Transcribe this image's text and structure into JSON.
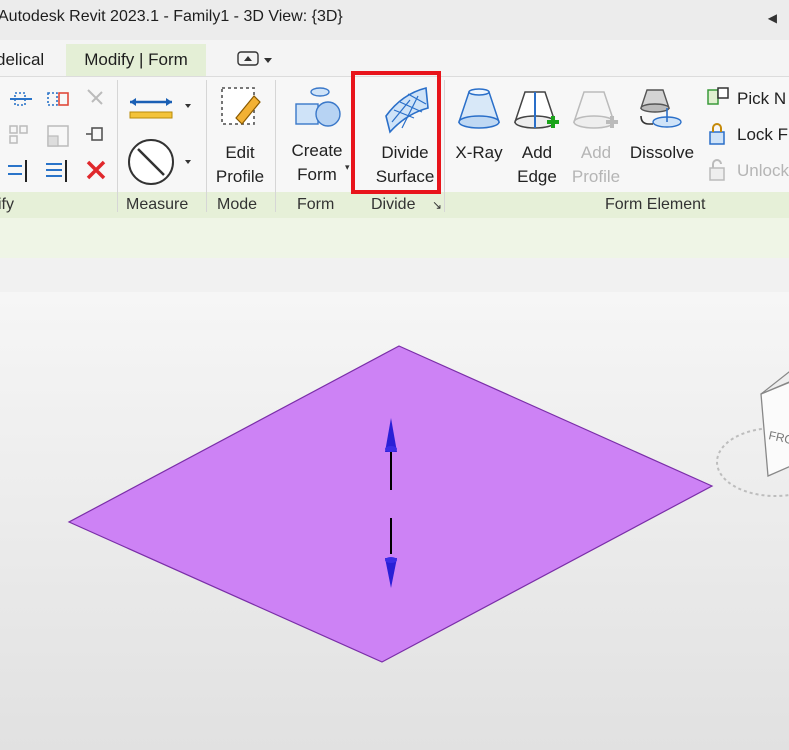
{
  "titlebar": {
    "title": "Autodesk Revit 2023.1 - Family1 - 3D View: {3D}"
  },
  "tabs": {
    "modelical": "delical",
    "modify_form": "Modify | Form"
  },
  "ribbon": {
    "panels": {
      "modify": "ify",
      "measure": "Measure",
      "mode": "Mode",
      "form": "Form",
      "divide": "Divide",
      "form_element": "Form Element"
    },
    "buttons": {
      "edit_profile": [
        "Edit",
        "Profile"
      ],
      "create_form": [
        "Create",
        "Form"
      ],
      "divide_surface": [
        "Divide",
        "Surface"
      ],
      "xray": "X-Ray",
      "add_edge": [
        "Add",
        "Edge"
      ],
      "add_profile": [
        "Add",
        "Profile"
      ],
      "dissolve": "Dissolve",
      "pick": "Pick",
      "pick_suffix": "N",
      "lock": "Lock",
      "lock_suffix": "F",
      "unlock": "Unlock"
    }
  },
  "viewcube": {
    "face_label": "FRO"
  },
  "colors": {
    "highlight": "#e8141b",
    "surface": "#cd82f5",
    "arrow": "#2a1fd6",
    "panel_bar": "#e6f0d8"
  }
}
